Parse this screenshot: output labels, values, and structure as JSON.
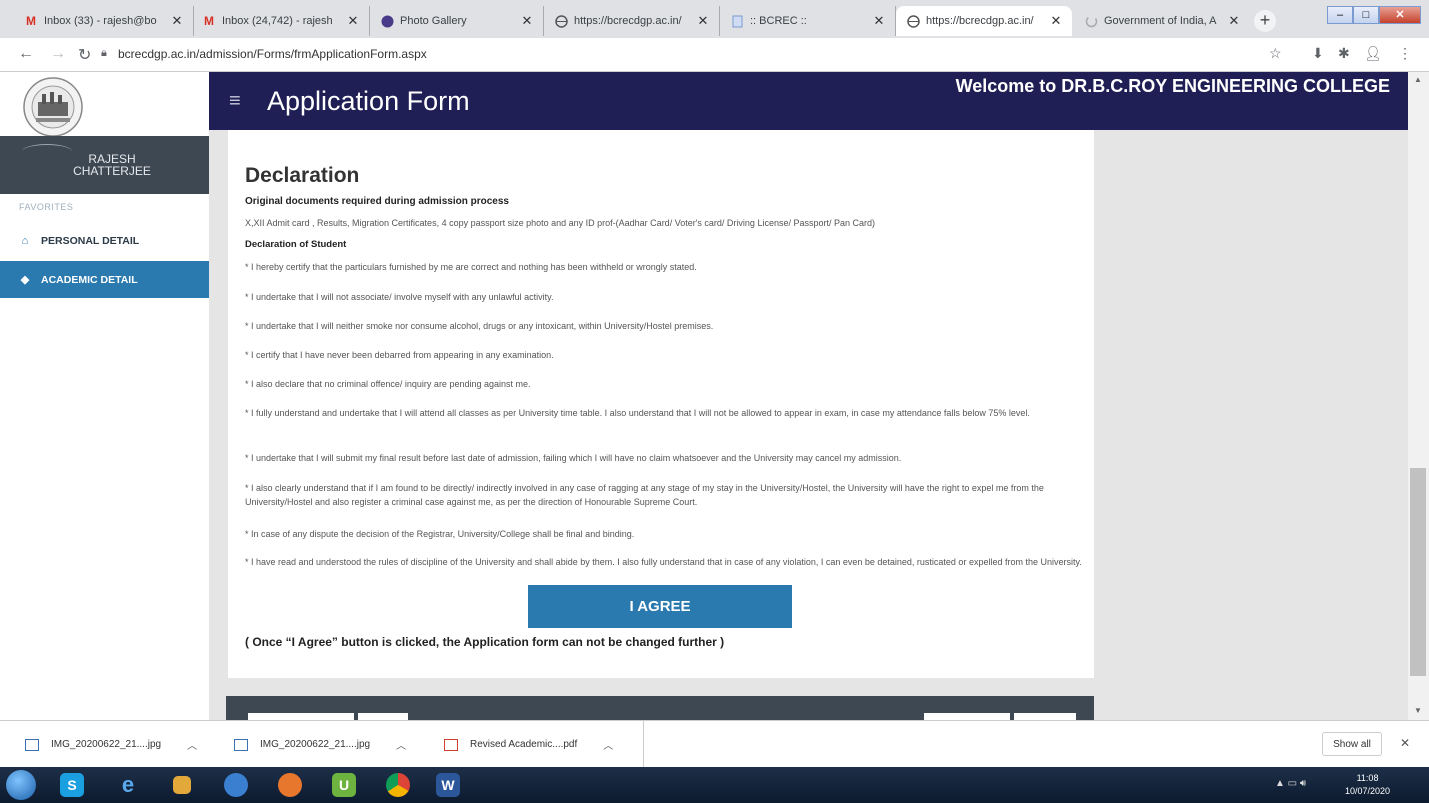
{
  "browser": {
    "tabs": [
      {
        "title": "Inbox (33) - rajesh@bo",
        "favicon": "gmail-icon",
        "favicon_color": "#d93025"
      },
      {
        "title": "Inbox (24,742) - rajesh",
        "favicon": "gmail-icon",
        "favicon_color": "#d93025"
      },
      {
        "title": "Photo Gallery",
        "favicon": "globe-icon",
        "favicon_color": "#4a3a8a"
      },
      {
        "title": "https://bcrecdgp.ac.in/",
        "favicon": "globe-icon",
        "favicon_color": "#555555"
      },
      {
        "title": ":: BCREC ::",
        "favicon": "page-icon",
        "favicon_color": "#7a9ad0"
      },
      {
        "title": "https://bcrecdgp.ac.in/",
        "favicon": "globe-icon",
        "favicon_color": "#555555"
      },
      {
        "title": "Government of India, A",
        "favicon": "loading-icon",
        "favicon_color": "#888888"
      }
    ],
    "new_tab_label": "+",
    "url": "bcrecdgp.ac.in/admission/Forms/frmApplicationForm.aspx"
  },
  "sidebar": {
    "user_name": "RAJESH CHATTERJEE",
    "favorites_label": "FAVORITES",
    "items": [
      {
        "label": "PERSONAL DETAIL",
        "icon": "home-icon"
      },
      {
        "label": "ACADEMIC DETAIL",
        "icon": "graduation-cap-icon"
      }
    ]
  },
  "header": {
    "title": "Application Form",
    "welcome": "Welcome to DR.B.C.ROY ENGINEERING COLLEGE"
  },
  "declaration": {
    "title": "Declaration",
    "docs_heading": "Original documents required during admission process",
    "docs_text": "X,XII Admit card , Results, Migration Certificates, 4 copy passport size photo and any ID prof-(Aadhar Card/ Voter's card/ Driving License/ Passport/ Pan Card)",
    "student_heading": "Declaration of Student",
    "statements": [
      "* I hereby certify that the particulars furnished by me are correct and nothing has been withheld or wrongly stated.",
      "* I undertake that I will not associate/ involve myself with any unlawful activity.",
      "* I undertake that I will neither smoke nor consume alcohol, drugs or any intoxicant, within University/Hostel premises.",
      "* I certify that I have never been debarred from appearing in any examination.",
      "* I also declare that no criminal offence/ inquiry are pending against me.",
      "* I fully understand and undertake that I will attend all classes as per University time table. I also understand that I will not be allowed to appear in exam, in case my attendance falls below 75% level.",
      "* I undertake that I will submit my final result before last date of admission, failing which I will have no claim whatsoever and the University may cancel my admission.",
      "* I also clearly understand that if I am found to be directly/ indirectly involved in any case of ragging at any stage of my stay in the University/Hostel, the University will have the right to expel me from the University/Hostel and also register a criminal case against me, as per the direction of Honourable Supreme Court.",
      "* In case of any dispute the decision of the Registrar, University/College shall be final and binding.",
      "* I have read and understood the rules of discipline of the University and shall abide by them. I also fully understand that in case of any violation, I can even be detained, rusticated or expelled from the University."
    ],
    "agree_button": "I AGREE",
    "agree_note": "( Once “I Agree” button is clicked, the Application form can not be changed further )"
  },
  "downloads": {
    "items": [
      {
        "name": "IMG_20200622_21....jpg",
        "icon": "image-file-icon"
      },
      {
        "name": "IMG_20200622_21....jpg",
        "icon": "image-file-icon"
      },
      {
        "name": "Revised Academic....pdf",
        "icon": "pdf-file-icon"
      }
    ],
    "show_all": "Show all"
  },
  "taskbar": {
    "time": "11:08",
    "date": "10/07/2020"
  },
  "colors": {
    "header_bg": "#1f1f55",
    "accent": "#2a7ab0",
    "sidebar_user_bg": "#3d4852"
  }
}
